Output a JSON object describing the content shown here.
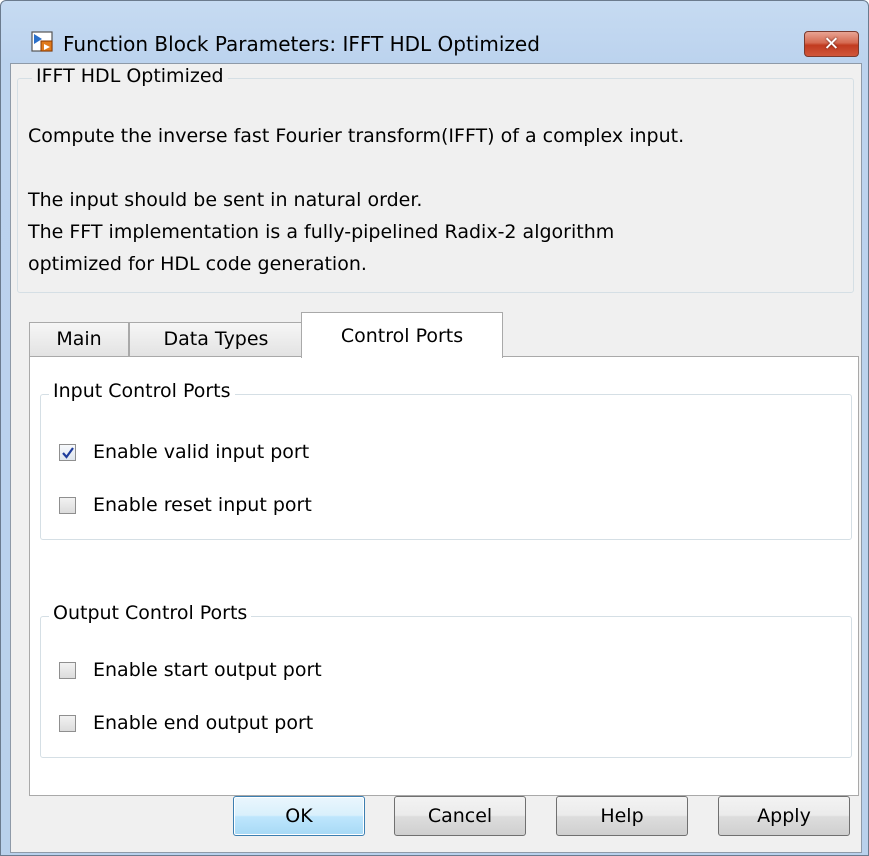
{
  "window": {
    "title": "Function Block Parameters: IFFT HDL Optimized",
    "close_label": "✕"
  },
  "description": {
    "group_title": "IFFT HDL Optimized",
    "lines": [
      "Compute the inverse fast Fourier transform(IFFT) of a complex input.",
      "The input should be sent in natural order.",
      "The FFT implementation is a fully-pipelined Radix-2 algorithm",
      "optimized for HDL code generation."
    ]
  },
  "tabs": [
    {
      "label": "Main",
      "active": false
    },
    {
      "label": "Data Types",
      "active": false
    },
    {
      "label": "Control Ports",
      "active": true
    }
  ],
  "input_group": {
    "title": "Input Control Ports",
    "options": [
      {
        "label": "Enable valid input port",
        "checked": true
      },
      {
        "label": "Enable reset input port",
        "checked": false
      }
    ]
  },
  "output_group": {
    "title": "Output Control Ports",
    "options": [
      {
        "label": "Enable start output port",
        "checked": false
      },
      {
        "label": "Enable end output port",
        "checked": false
      }
    ]
  },
  "buttons": {
    "ok": "OK",
    "cancel": "Cancel",
    "help": "Help",
    "apply": "Apply"
  },
  "colors": {
    "accent": "#3c7fb1",
    "close": "#c13b20",
    "check": "#1e3c9c"
  }
}
